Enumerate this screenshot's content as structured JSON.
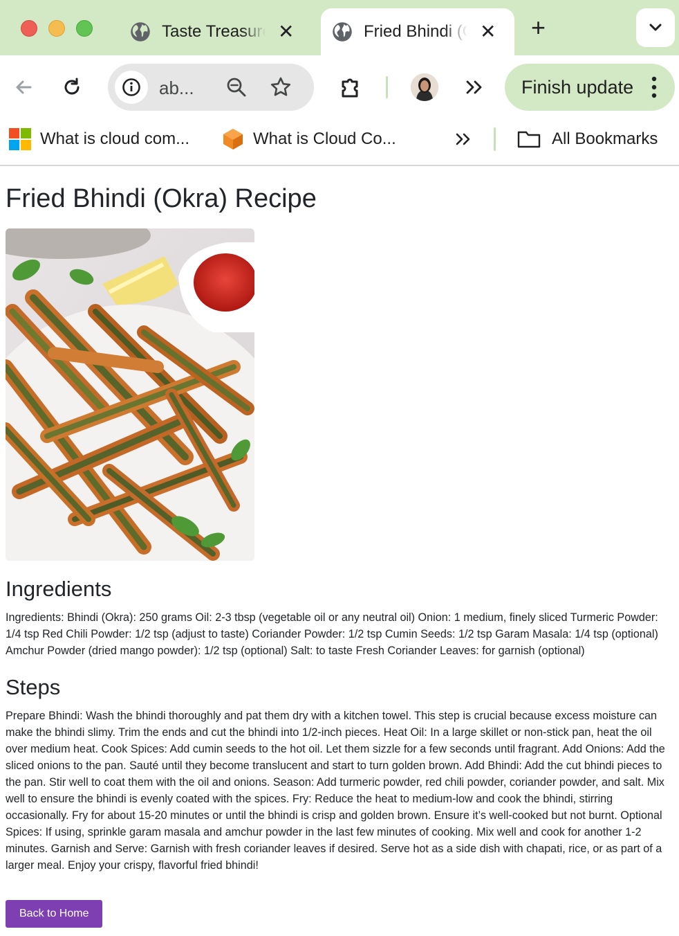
{
  "browser": {
    "tabs": [
      {
        "title": "Taste Treasures",
        "active": false
      },
      {
        "title": "Fried Bhindi (Okra) Recipe",
        "active": true
      }
    ],
    "omnibox": {
      "url_text": "ab..."
    },
    "finish_update_label": "Finish update",
    "bookmarks": [
      {
        "label": "What is cloud com...",
        "icon": "windows-logo-icon"
      },
      {
        "label": "What is Cloud Co...",
        "icon": "orange-cube-icon"
      }
    ],
    "all_bookmarks_label": "All Bookmarks"
  },
  "page": {
    "title": "Fried Bhindi (Okra) Recipe",
    "image_alt": "Fried Bhindi",
    "ingredients_heading": "Ingredients",
    "ingredients_text": "Ingredients: Bhindi (Okra): 250 grams Oil: 2-3 tbsp (vegetable oil or any neutral oil) Onion: 1 medium, finely sliced Turmeric Powder: 1/4 tsp Red Chili Powder: 1/2 tsp (adjust to taste) Coriander Powder: 1/2 tsp Cumin Seeds: 1/2 tsp Garam Masala: 1/4 tsp (optional) Amchur Powder (dried mango powder): 1/2 tsp (optional) Salt: to taste Fresh Coriander Leaves: for garnish (optional)",
    "steps_heading": "Steps",
    "steps_text": "Prepare Bhindi: Wash the bhindi thoroughly and pat them dry with a kitchen towel. This step is crucial because excess moisture can make the bhindi slimy. Trim the ends and cut the bhindi into 1/2-inch pieces. Heat Oil: In a large skillet or non-stick pan, heat the oil over medium heat. Cook Spices: Add cumin seeds to the hot oil. Let them sizzle for a few seconds until fragrant. Add Onions: Add the sliced onions to the pan. Sauté until they become translucent and start to turn golden brown. Add Bhindi: Add the cut bhindi pieces to the pan. Stir well to coat them with the oil and onions. Season: Add turmeric powder, red chili powder, coriander powder, and salt. Mix well to ensure the bhindi is evenly coated with the spices. Fry: Reduce the heat to medium-low and cook the bhindi, stirring occasionally. Fry for about 15-20 minutes or until the bhindi is crisp and golden brown. Ensure it’s well-cooked but not burnt. Optional Spices: If using, sprinkle garam masala and amchur powder in the last few minutes of cooking. Mix well and cook for another 1-2 minutes. Garnish and Serve: Garnish with fresh coriander leaves if desired. Serve hot as a side dish with chapati, rice, or as part of a larger meal. Enjoy your crispy, flavorful fried bhindi!",
    "back_button_label": "Back to Home"
  },
  "colors": {
    "chrome_accent": "#d3e9c5",
    "button_purple": "#7e3fb3",
    "text": "#212529"
  }
}
